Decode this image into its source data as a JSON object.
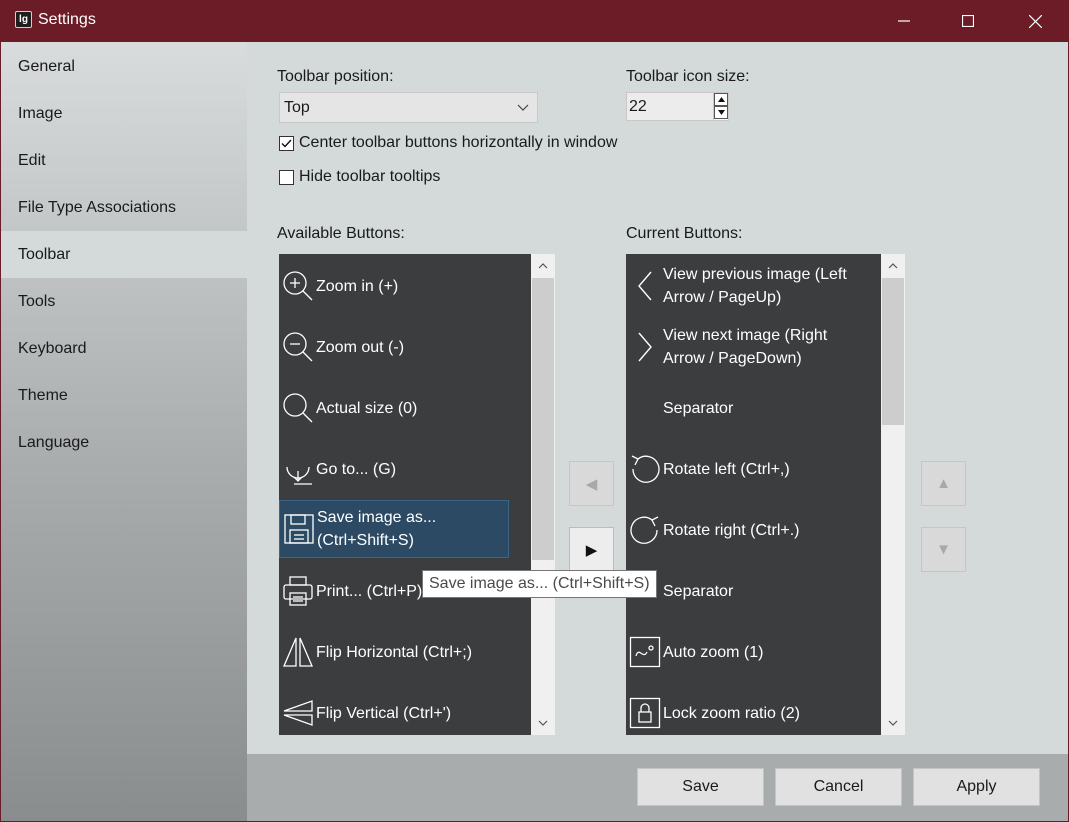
{
  "window": {
    "title": "Settings",
    "app_icon_text": "lg",
    "controls": {
      "minimize": "minimize",
      "maximize": "maximize",
      "close": "close"
    }
  },
  "sidebar": {
    "items": [
      {
        "label": "General"
      },
      {
        "label": "Image"
      },
      {
        "label": "Edit"
      },
      {
        "label": "File Type Associations"
      },
      {
        "label": "Toolbar",
        "active": true
      },
      {
        "label": "Tools"
      },
      {
        "label": "Keyboard"
      },
      {
        "label": "Theme"
      },
      {
        "label": "Language"
      }
    ]
  },
  "toolbar_settings": {
    "position_label": "Toolbar position:",
    "position_value": "Top",
    "icon_size_label": "Toolbar icon size:",
    "icon_size_value": "22",
    "center_label": "Center toolbar buttons horizontally in window",
    "center_checked": true,
    "hide_tooltips_label": "Hide toolbar tooltips",
    "hide_tooltips_checked": false
  },
  "available": {
    "heading": "Available Buttons:",
    "items": [
      {
        "icon": "zoom-in-icon",
        "label": "Zoom in (+)"
      },
      {
        "icon": "zoom-out-icon",
        "label": "Zoom out (-)"
      },
      {
        "icon": "actual-size-icon",
        "label": "Actual size (0)"
      },
      {
        "icon": "go-to-icon",
        "label": "Go to... (G)"
      },
      {
        "icon": "save-icon",
        "label_line1": "Save image as...",
        "label_line2": "(Ctrl+Shift+S)",
        "selected": true
      },
      {
        "icon": "printer-icon",
        "label": "Print... (Ctrl+P)"
      },
      {
        "icon": "flip-horizontal-icon",
        "label": "Flip Horizontal (Ctrl+;)"
      },
      {
        "icon": "flip-vertical-icon",
        "label": "Flip Vertical (Ctrl+')"
      }
    ]
  },
  "current": {
    "heading": "Current Buttons:",
    "items": [
      {
        "icon": "chevron-left-icon",
        "label_line1": "View previous image (Left",
        "label_line2": "Arrow / PageUp)"
      },
      {
        "icon": "chevron-right-icon",
        "label_line1": "View next image (Right",
        "label_line2": "Arrow / PageDown)"
      },
      {
        "icon": "none",
        "label": "Separator"
      },
      {
        "icon": "rotate-left-icon",
        "label": "Rotate left (Ctrl+,)"
      },
      {
        "icon": "rotate-right-icon",
        "label": "Rotate right (Ctrl+.)"
      },
      {
        "icon": "none",
        "label": "Separator"
      },
      {
        "icon": "auto-zoom-icon",
        "label": "Auto zoom (1)"
      },
      {
        "icon": "lock-icon",
        "label": "Lock zoom ratio (2)"
      }
    ]
  },
  "transfer": {
    "remove_glyph": "◀",
    "add_glyph": "▶",
    "up_glyph": "▲",
    "down_glyph": "▼"
  },
  "tooltip": {
    "text": "Save image as... (Ctrl+Shift+S)"
  },
  "footer": {
    "save": "Save",
    "cancel": "Cancel",
    "apply": "Apply"
  },
  "colors": {
    "titlebar": "#6b1c27",
    "list_bg": "#3b3d3e",
    "selected": "#2c4a64",
    "panel": "#d3dad9"
  }
}
